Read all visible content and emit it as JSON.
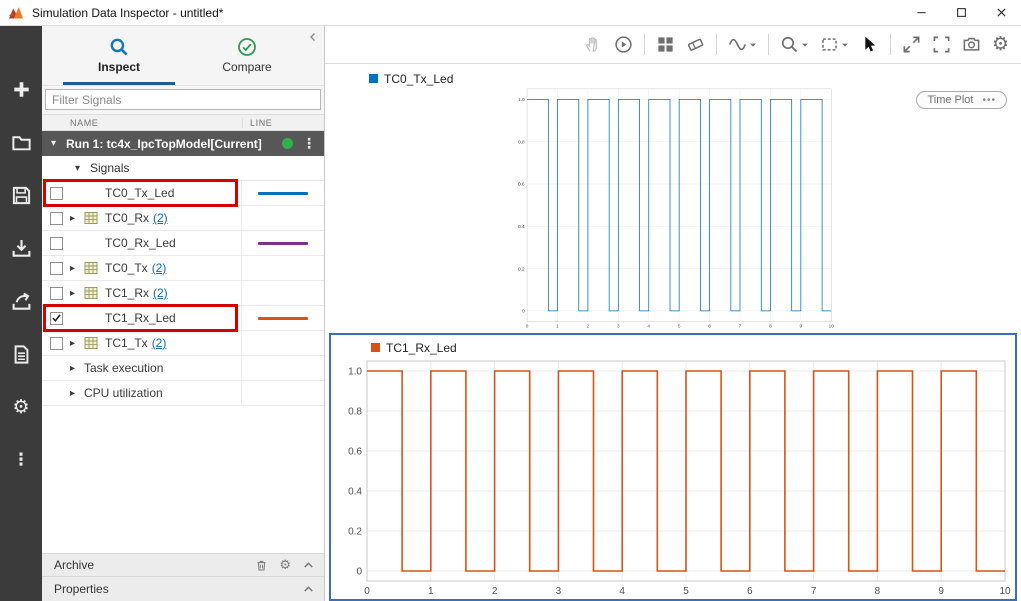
{
  "window": {
    "title": "Simulation Data Inspector - untitled*"
  },
  "left_toolbar": {
    "items": [
      {
        "name": "add",
        "icon": "plus"
      },
      {
        "name": "open",
        "icon": "folder"
      },
      {
        "name": "save",
        "icon": "save"
      },
      {
        "name": "import",
        "icon": "import"
      },
      {
        "name": "export",
        "icon": "export"
      },
      {
        "name": "create-report",
        "icon": "report"
      },
      {
        "name": "preferences",
        "icon": "gear"
      },
      {
        "name": "more-options",
        "icon": "ellipsis-v"
      }
    ]
  },
  "sidebar": {
    "tabs": [
      {
        "label": "Inspect",
        "active": true
      },
      {
        "label": "Compare",
        "active": false
      }
    ],
    "filter_placeholder": "Filter Signals",
    "table": {
      "columns": [
        "NAME",
        "LINE"
      ],
      "run_header": "Run 1: tc4x_IpcTopModel[Current]",
      "signals_group": "Signals",
      "rows": [
        {
          "label": "TC0_Tx_Led",
          "checkbox": true,
          "checked": false,
          "line_color": "#0072BD",
          "highlighted": true
        },
        {
          "label": "TC0_Rx",
          "count": "(2)",
          "checkbox": true,
          "checked": false,
          "expandable": true,
          "grid_icon": true
        },
        {
          "label": "TC0_Rx_Led",
          "checkbox": true,
          "checked": false,
          "line_color": "#7E2F8E"
        },
        {
          "label": "TC0_Tx",
          "count": "(2)",
          "checkbox": true,
          "checked": false,
          "expandable": true,
          "grid_icon": true
        },
        {
          "label": "TC1_Rx",
          "count": "(2)",
          "checkbox": true,
          "checked": false,
          "expandable": true,
          "grid_icon": true
        },
        {
          "label": "TC1_Rx_Led",
          "checkbox": true,
          "checked": true,
          "line_color": "#D95319",
          "highlighted": true
        },
        {
          "label": "TC1_Tx",
          "count": "(2)",
          "checkbox": true,
          "checked": false,
          "expandable": true,
          "grid_icon": true
        },
        {
          "label": "Task execution",
          "checkbox": false,
          "expandable": true
        },
        {
          "label": "CPU utilization",
          "checkbox": false,
          "expandable": true
        }
      ]
    },
    "archive": {
      "label": "Archive"
    },
    "properties": {
      "label": "Properties"
    }
  },
  "plot_toolbar": {
    "items": [
      {
        "icon": "hand",
        "name": "pan",
        "disabled": true
      },
      {
        "icon": "playcircle",
        "name": "replay"
      },
      {
        "sep": true
      },
      {
        "icon": "layout",
        "name": "subplot-layout"
      },
      {
        "icon": "eraser",
        "name": "clear-subplots"
      },
      {
        "sep": true
      },
      {
        "icon": "wave",
        "name": "signal-styles",
        "caret": true
      },
      {
        "sep": true
      },
      {
        "icon": "zoom",
        "name": "zoom-menu",
        "caret": true
      },
      {
        "icon": "fitview",
        "name": "fit-to-view",
        "caret": true
      },
      {
        "icon": "cursor",
        "name": "pointer-mode",
        "active": true
      },
      {
        "sep": true
      },
      {
        "icon": "expand",
        "name": "maximize-plot"
      },
      {
        "icon": "fullscreen",
        "name": "full-screen"
      },
      {
        "icon": "camera",
        "name": "snapshot"
      },
      {
        "icon": "gear",
        "name": "visualization-settings"
      }
    ]
  },
  "plots": {
    "type_button": {
      "label": "Time Plot",
      "menu": "•••"
    }
  },
  "chart_data": [
    {
      "type": "line",
      "subtype": "square-wave-step",
      "title": "TC0_Tx_Led",
      "color": "#0072BD",
      "selected": false,
      "show_type_button": true,
      "xlim": [
        0,
        10
      ],
      "ylim": [
        -0.05,
        1.05
      ],
      "x_ticks": [
        0,
        1,
        2,
        3,
        4,
        5,
        6,
        7,
        8,
        9,
        10
      ],
      "y_ticks": [
        0,
        0.2,
        0.4,
        0.6,
        0.8,
        1
      ],
      "y_tick_labels": [
        "0",
        "0.2",
        "0.4",
        "0.6",
        "0.8",
        "1.0"
      ],
      "grid": true,
      "legend_position": "top-left",
      "steps": [
        [
          0,
          1
        ],
        [
          0.7,
          0
        ],
        [
          1,
          1
        ],
        [
          1.7,
          0
        ],
        [
          2,
          1
        ],
        [
          2.7,
          0
        ],
        [
          3,
          1
        ],
        [
          3.7,
          0
        ],
        [
          4,
          1
        ],
        [
          4.7,
          0
        ],
        [
          5,
          1
        ],
        [
          5.7,
          0
        ],
        [
          6,
          1
        ],
        [
          6.7,
          0
        ],
        [
          7,
          1
        ],
        [
          7.7,
          0
        ],
        [
          8,
          1
        ],
        [
          8.7,
          0
        ],
        [
          9,
          1
        ],
        [
          9.7,
          0
        ]
      ]
    },
    {
      "type": "line",
      "subtype": "square-wave-step",
      "title": "TC1_Rx_Led",
      "color": "#D95319",
      "selected": true,
      "show_type_button": false,
      "xlim": [
        0,
        10
      ],
      "ylim": [
        -0.05,
        1.05
      ],
      "x_ticks": [
        0,
        1,
        2,
        3,
        4,
        5,
        6,
        7,
        8,
        9,
        10
      ],
      "y_ticks": [
        0,
        0.2,
        0.4,
        0.6,
        0.8,
        1
      ],
      "y_tick_labels": [
        "0",
        "0.2",
        "0.4",
        "0.6",
        "0.8",
        "1.0"
      ],
      "grid": true,
      "legend_position": "top-left",
      "steps": [
        [
          0,
          1
        ],
        [
          0.55,
          0
        ],
        [
          1,
          1
        ],
        [
          1.55,
          0
        ],
        [
          2,
          1
        ],
        [
          2.55,
          0
        ],
        [
          3,
          1
        ],
        [
          3.55,
          0
        ],
        [
          4,
          1
        ],
        [
          4.55,
          0
        ],
        [
          5,
          1
        ],
        [
          5.55,
          0
        ],
        [
          6,
          1
        ],
        [
          6.55,
          0
        ],
        [
          7,
          1
        ],
        [
          7.55,
          0
        ],
        [
          8,
          1
        ],
        [
          8.55,
          0
        ],
        [
          9,
          1
        ],
        [
          9.55,
          0
        ]
      ]
    }
  ]
}
